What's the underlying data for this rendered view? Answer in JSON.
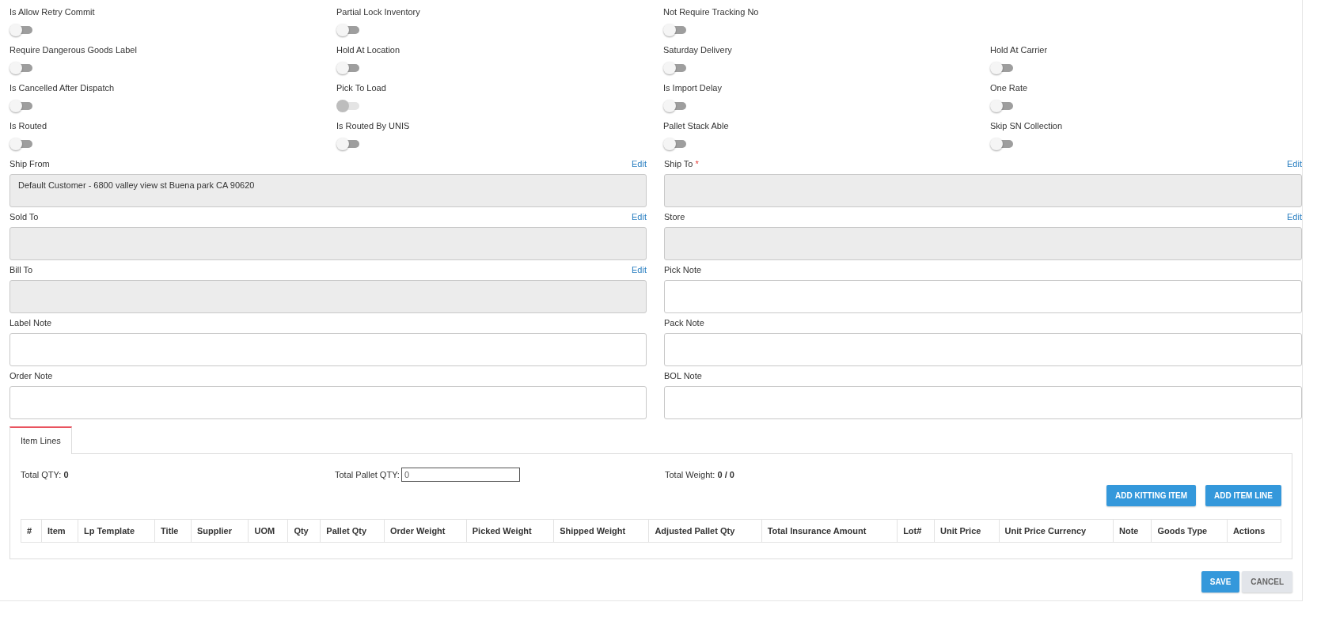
{
  "toggle_rows": [
    [
      {
        "label": "Is Allow Retry Commit",
        "on": false,
        "disabled": false
      },
      {
        "label": "Partial Lock Inventory",
        "on": false,
        "disabled": false
      },
      {
        "label": "Not Require Tracking No",
        "on": false,
        "disabled": false
      }
    ],
    [
      {
        "label": "Require Dangerous Goods Label",
        "on": false,
        "disabled": false
      },
      {
        "label": "Hold At Location",
        "on": false,
        "disabled": false
      },
      {
        "label": "Saturday Delivery",
        "on": false,
        "disabled": false
      },
      {
        "label": "Hold At Carrier",
        "on": false,
        "disabled": false
      }
    ],
    [
      {
        "label": "Is Cancelled After Dispatch",
        "on": false,
        "disabled": false
      },
      {
        "label": "Pick To Load",
        "on": false,
        "disabled": true
      },
      {
        "label": "Is Import Delay",
        "on": false,
        "disabled": false
      },
      {
        "label": "One Rate",
        "on": false,
        "disabled": false
      }
    ],
    [
      {
        "label": "Is Routed",
        "on": false,
        "disabled": false
      },
      {
        "label": "Is Routed By UNIS",
        "on": false,
        "disabled": false
      },
      {
        "label": "Pallet Stack Able",
        "on": false,
        "disabled": false
      },
      {
        "label": "Skip SN Collection",
        "on": false,
        "disabled": false
      }
    ]
  ],
  "field_rows": [
    [
      {
        "label": "Ship From",
        "edit": "Edit",
        "kind": "readonly",
        "value": "Default Customer - 6800 valley view st Buena park CA 90620"
      },
      {
        "label": "Ship To",
        "required_mark": "*",
        "edit": "Edit",
        "kind": "readonly"
      }
    ],
    [
      {
        "label": "Sold To",
        "edit": "Edit",
        "kind": "readonly"
      },
      {
        "label": "Store",
        "edit": "Edit",
        "kind": "readonly"
      }
    ],
    [
      {
        "label": "Bill To",
        "edit": "Edit",
        "kind": "readonly"
      },
      {
        "label": "Pick Note",
        "kind": "note"
      }
    ],
    [
      {
        "label": "Label Note",
        "kind": "note"
      },
      {
        "label": "Pack Note",
        "kind": "note"
      }
    ],
    [
      {
        "label": "Order Note",
        "kind": "note"
      },
      {
        "label": "BOL Note",
        "kind": "note"
      }
    ]
  ],
  "tabs": [
    {
      "label": "Item Lines",
      "selected": true
    }
  ],
  "item_lines": {
    "total_qty": "Total QTY: **0**",
    "total_pallet_qty_label": "Total Pallet QTY:",
    "total_pallet_qty_value": "0",
    "total_weight": "Total Weight: **0 / 0**",
    "buttons": [
      "ADD KITTING ITEM",
      "ADD ITEM LINE"
    ],
    "columns": [
      "#",
      "Item",
      "Lp Template",
      "Title",
      "Supplier",
      "UOM",
      "Qty",
      "Pallet Qty",
      "Order Weight",
      "Picked Weight",
      "Shipped Weight",
      "Adjusted Pallet Qty",
      "Total Insurance Amount",
      "Lot#",
      "Unit Price",
      "Unit Price Currency",
      "Note",
      "Goods Type",
      "Actions"
    ]
  },
  "footer_buttons": [
    {
      "label": "SAVE",
      "kind": "primary"
    },
    {
      "label": "CANCEL",
      "kind": "secondary"
    }
  ]
}
